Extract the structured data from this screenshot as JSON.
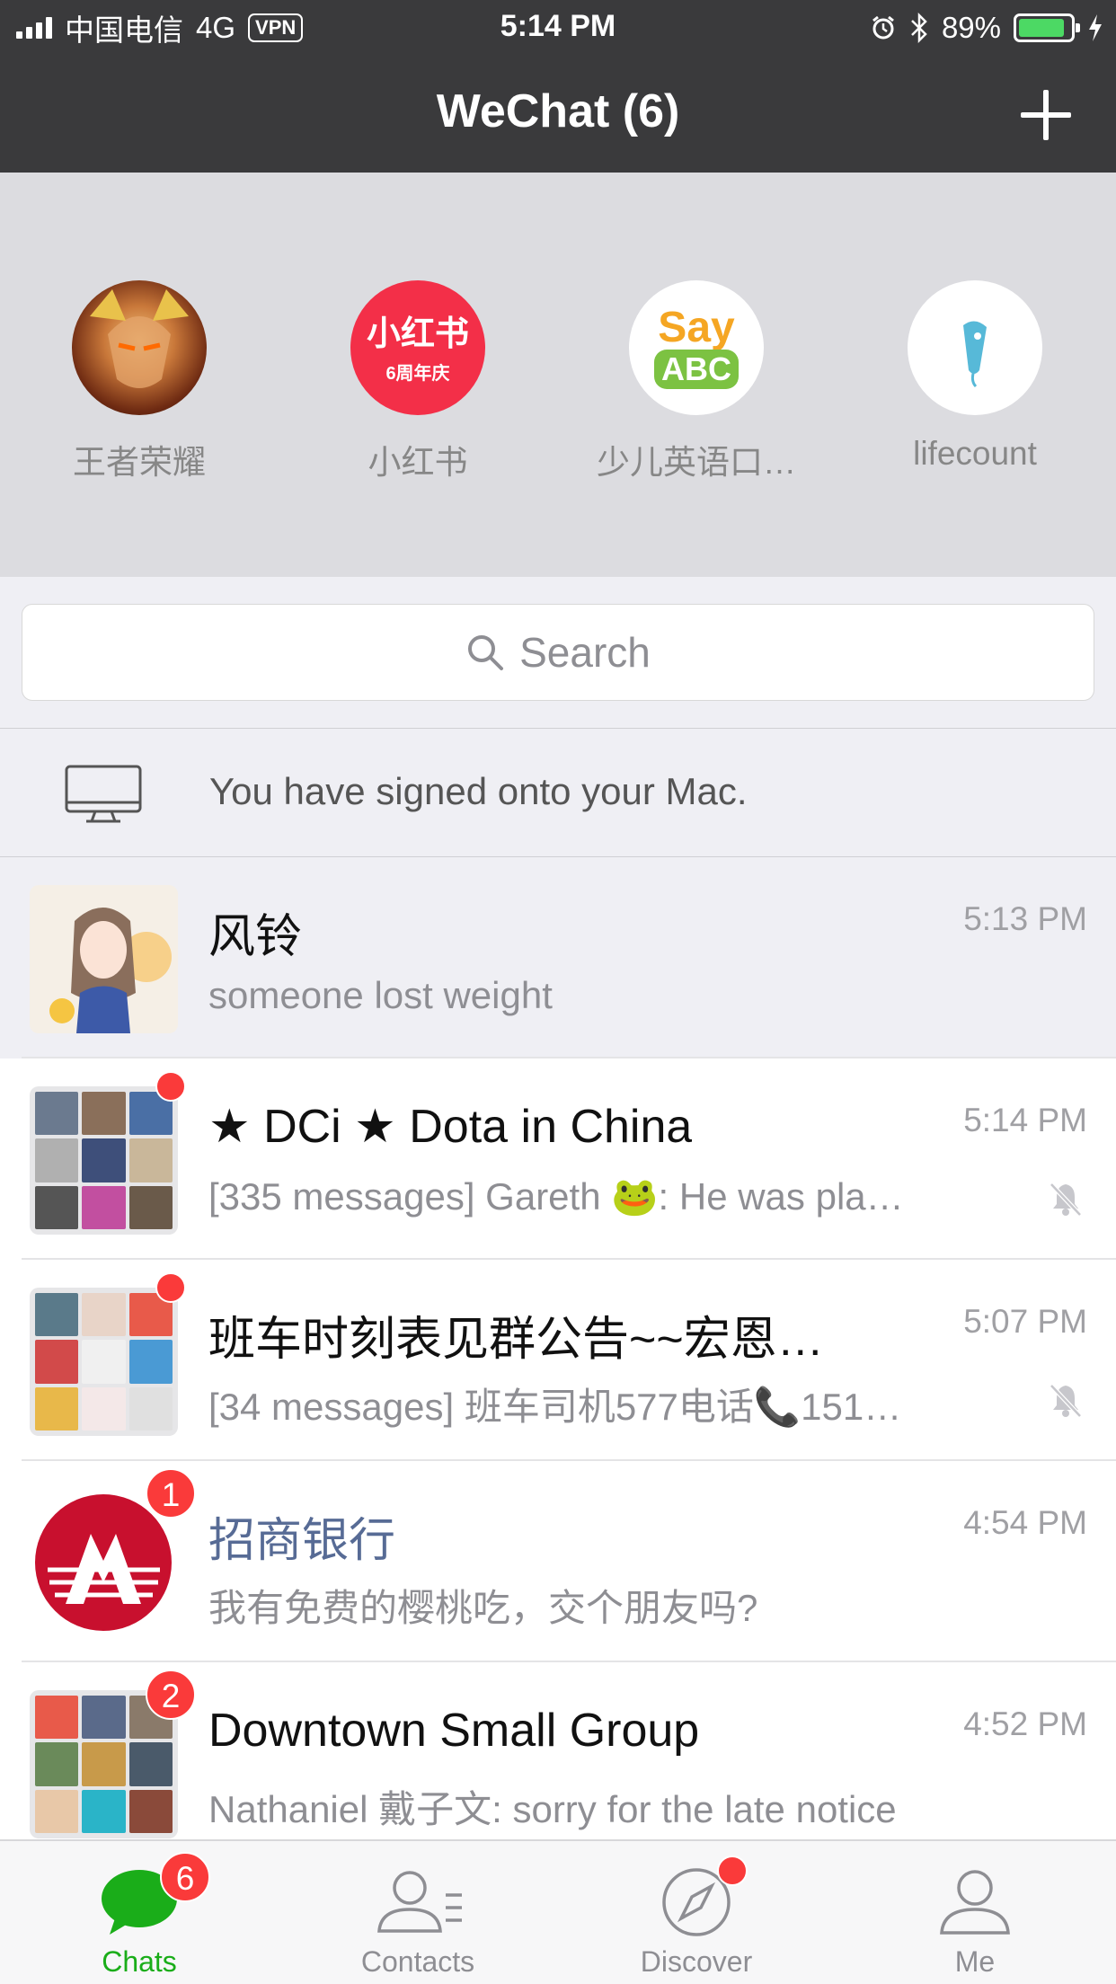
{
  "status_bar": {
    "carrier": "中国电信",
    "network": "4G",
    "vpn": "VPN",
    "time": "5:14 PM",
    "battery": "89%",
    "battery_level": 0.89
  },
  "nav": {
    "title": "WeChat (6)"
  },
  "mini_programs": [
    {
      "label": "王者荣耀",
      "icon": "game-hero-avatar"
    },
    {
      "label": "小红书",
      "icon": "xiaohongshu-logo",
      "logo_text": "小红书",
      "logo_sub": "6周年庆"
    },
    {
      "label": "少儿英语口…",
      "icon": "say-abc-logo",
      "logo_text": "Say",
      "logo_sub": "ABC"
    },
    {
      "label": "lifecount",
      "icon": "lifecount-logo"
    }
  ],
  "search": {
    "placeholder": "Search"
  },
  "mac_notice": {
    "text": "You have signed onto your Mac."
  },
  "chats": [
    {
      "title": "风铃",
      "preview": "someone lost weight",
      "time": "5:13 PM"
    },
    {
      "title": "★ DCi ★ Dota in China",
      "preview": "[335 messages] Gareth 🐸: He was pla…",
      "time": "5:14 PM"
    },
    {
      "title": "班车时刻表见群公告~~宏恩…",
      "preview": "[34 messages] 班车司机577电话📞151…",
      "time": "5:07 PM"
    },
    {
      "title": "招商银行",
      "preview": "我有免费的樱桃吃，交个朋友吗?",
      "time": "4:54 PM",
      "badge": "1"
    },
    {
      "title": "Downtown Small Group",
      "preview": "Nathaniel 戴子文: sorry for the late notice",
      "time": "4:52 PM",
      "badge": "2"
    }
  ],
  "tabs": [
    {
      "label": "Chats",
      "badge": "6"
    },
    {
      "label": "Contacts"
    },
    {
      "label": "Discover"
    },
    {
      "label": "Me"
    }
  ],
  "colors": {
    "accent": "#1aad19",
    "badge": "#fa3a3a",
    "nav_bg": "#3a3a3c"
  }
}
